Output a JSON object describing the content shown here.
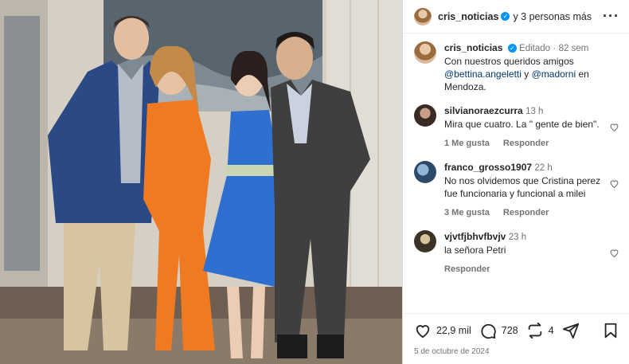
{
  "header": {
    "username": "cris_noticias",
    "collab_text": "y 3 personas más"
  },
  "caption": {
    "username": "cris_noticias",
    "edited": "Editado",
    "dot": "·",
    "age": "82 sem",
    "text_1": "Con nuestros queridos amigos",
    "mention_1": "@bettina.angeletti",
    "text_2": "y",
    "mention_2": "@madorni",
    "text_3": "en Mendoza."
  },
  "comments": [
    {
      "username": "silvianoraezcurra",
      "age": "13 h",
      "text": "Mira que cuatro. La \" gente de bien\".",
      "likes": "1 Me gusta",
      "reply": "Responder"
    },
    {
      "username": "franco_grosso1907",
      "age": "22 h",
      "text": "No nos olvidemos que Cristina perez fue funcionaria y funcional a milei",
      "likes": "3 Me gusta",
      "reply": "Responder"
    },
    {
      "username": "vjvtfjbhvfbvjv",
      "age": "23 h",
      "text": "la señora Petri",
      "likes": "",
      "reply": "Responder"
    }
  ],
  "footer": {
    "likes_count": "22,9 mil",
    "comments_count": "728",
    "reposts_count": "4",
    "date": "5 de octubre de 2024"
  },
  "icons": {
    "verified": "verified-badge-icon",
    "more": "more-options-icon",
    "like": "heart-icon",
    "comment": "comment-bubble-icon",
    "repost": "repost-icon",
    "share": "send-icon",
    "save": "bookmark-icon"
  },
  "colors": {
    "verified": "#0095f6",
    "mention": "#00376b",
    "muted": "#737373"
  }
}
